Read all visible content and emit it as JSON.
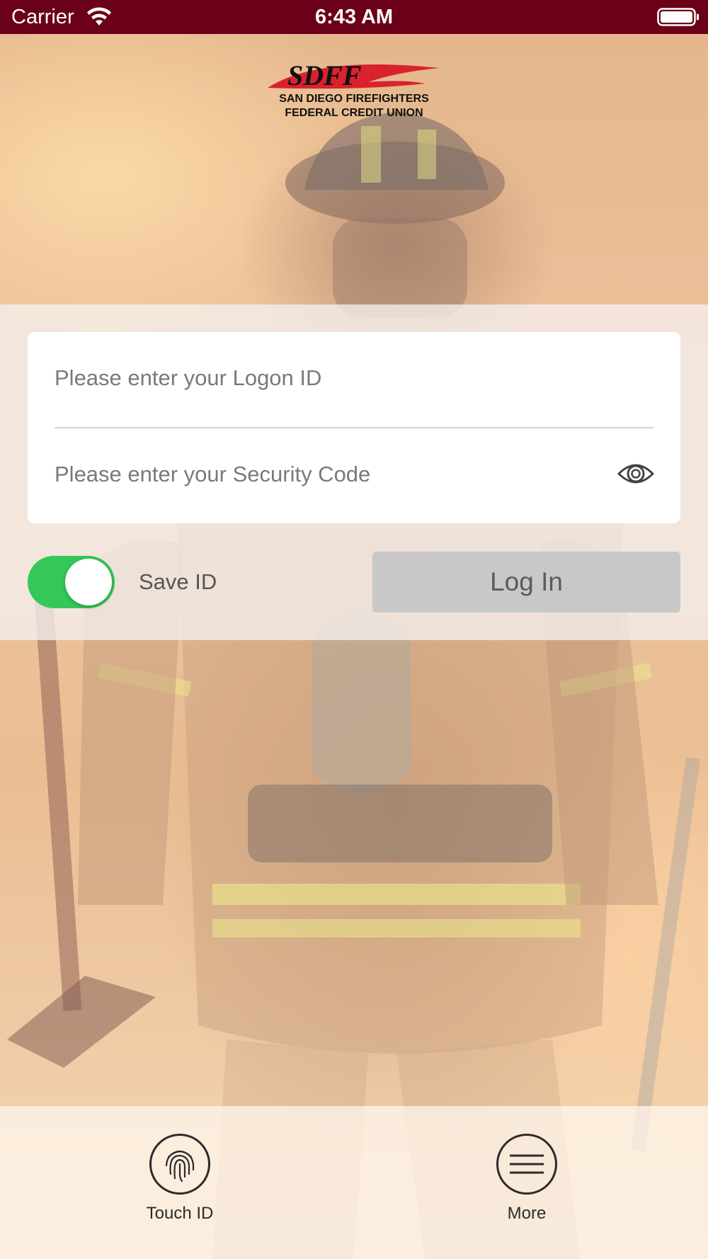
{
  "status_bar": {
    "carrier": "Carrier",
    "time": "6:43 AM"
  },
  "logo": {
    "abbreviation": "SDFF",
    "line1": "SAN DIEGO FIREFIGHTERS",
    "line2": "FEDERAL CREDIT UNION"
  },
  "login_form": {
    "logon_id_placeholder": "Please enter your Logon ID",
    "security_code_placeholder": "Please enter your Security Code",
    "show_password_icon": "eye-icon",
    "save_id_label": "Save ID",
    "save_id_enabled": true,
    "login_button_label": "Log In"
  },
  "bottom_bar": {
    "touch_id_label": "Touch ID",
    "touch_id_icon": "fingerprint-icon",
    "more_label": "More",
    "more_icon": "menu-icon"
  },
  "colors": {
    "status_bar": "#6b0019",
    "toggle_on": "#34c759",
    "login_button": "#c8c8c8",
    "logo_red": "#d8222e"
  }
}
